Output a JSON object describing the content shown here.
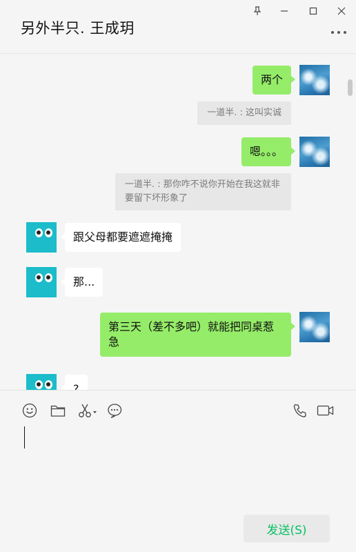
{
  "header": {
    "title": "另外半只. 王成玥"
  },
  "icons": {
    "pin": "pin-icon",
    "minimize": "minimize-icon",
    "maximize": "maximize-icon",
    "close": "close-icon",
    "more": "more-icon",
    "emoji": "emoji-icon",
    "file": "folder-icon",
    "screenshot": "scissors-icon",
    "chat_history": "chat-history-icon",
    "voice_call": "phone-icon",
    "video_call": "video-icon"
  },
  "colors": {
    "my_bubble": "#95ec69",
    "their_bubble": "#ffffff",
    "send_text": "#07c160",
    "background": "#f5f5f5"
  },
  "messages": [
    {
      "sender": "me",
      "text": "两个"
    },
    {
      "type": "quote",
      "text": "一道半. : 这叫实诚"
    },
    {
      "sender": "me",
      "text": "嗯。。。"
    },
    {
      "type": "quote",
      "text": "一道半. : 那你咋不说你开始在我这就非要留下坏形象了"
    },
    {
      "sender": "them",
      "text": "跟父母都要遮遮掩掩"
    },
    {
      "sender": "them",
      "text": "那..."
    },
    {
      "sender": "me",
      "text": "第三天（差不多吧）就能把同桌惹急"
    },
    {
      "sender": "them",
      "text": "?"
    }
  ],
  "composer": {
    "send_label": "发送(S)"
  }
}
